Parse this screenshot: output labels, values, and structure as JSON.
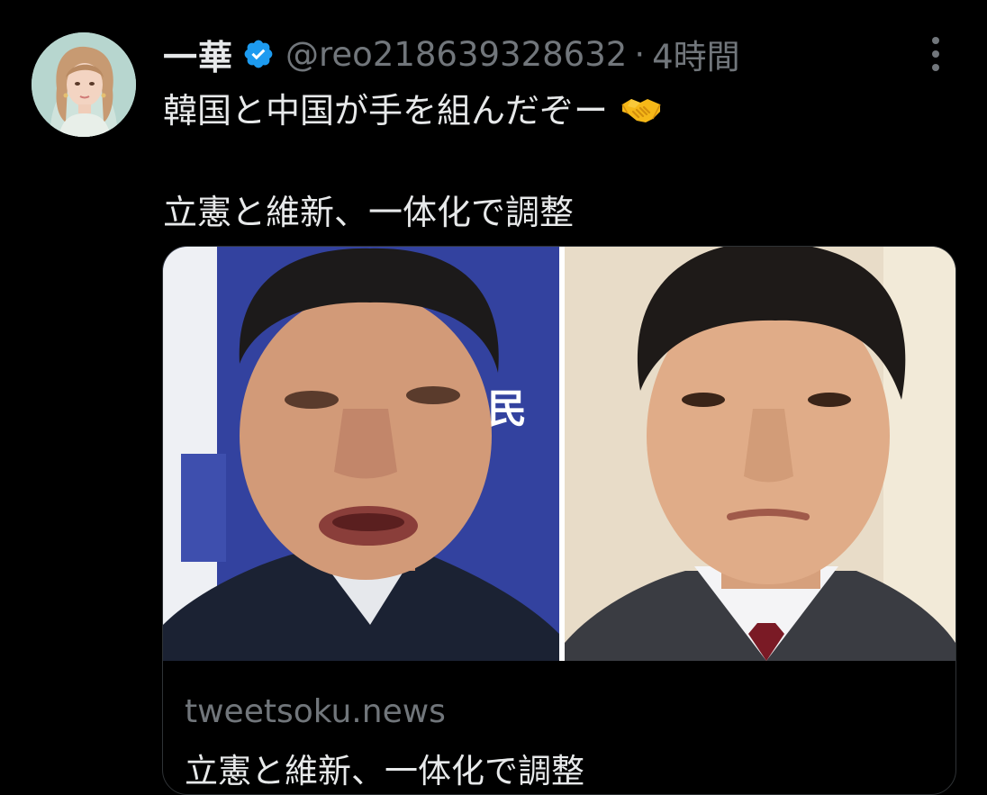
{
  "tweet": {
    "display_name": "一華",
    "handle": "@reo218639328632",
    "separator": "·",
    "time": "4時間",
    "verified": true,
    "text_line1": "韓国と中国が手を組んだぞー",
    "text_line2": "立憲と維新、一体化で調整",
    "emoji": "handshake-emoji"
  },
  "card": {
    "domain": "tweetsoku.news",
    "title": "立憲と維新、一体化で調整",
    "backdrop_text": "民"
  },
  "colors": {
    "background": "#000000",
    "text_primary": "#e7e9ea",
    "text_secondary": "#71767b",
    "verified_blue": "#1d9bf0",
    "card_border": "#2f3336"
  }
}
